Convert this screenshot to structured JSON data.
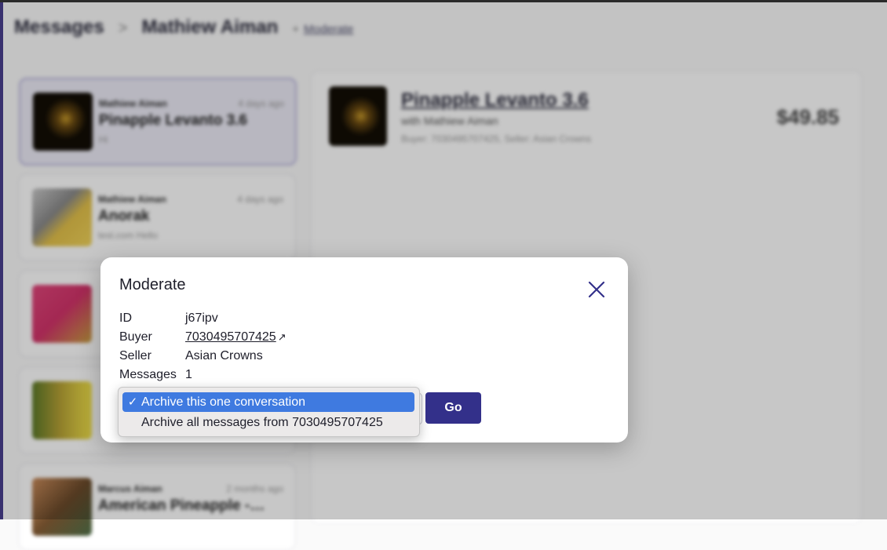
{
  "background": {
    "breadcrumb": {
      "messages": "Messages",
      "separator": ">",
      "user": "Mathiew Aiman",
      "plus": "+",
      "moderate_link": "Moderate"
    },
    "conversations": [
      {
        "seller": "Mathiew Aiman",
        "time": "4 days ago",
        "title": "Pinapple Levanto 3.6",
        "snippet": "Hi",
        "active": true
      },
      {
        "seller": "Mathiew Aiman",
        "time": "4 days ago",
        "title": "Anorak",
        "snippet": "test.com Hello",
        "active": false
      },
      {
        "seller": "",
        "time": "",
        "title": "",
        "snippet": "",
        "active": false
      },
      {
        "seller": "",
        "time": "",
        "title": "",
        "snippet": "",
        "active": false
      },
      {
        "seller": "Marcus Aiman",
        "time": "2 months ago",
        "title": "American Pineapple -…",
        "snippet": "",
        "active": false
      }
    ],
    "detail": {
      "title": "Pinapple Levanto 3.6",
      "with_text": "with Mathiew Aiman",
      "sub_text": "Buyer: 7030495707425, Seller: Asian Crowns",
      "price": "$49.85"
    }
  },
  "modal": {
    "title": "Moderate",
    "fields": [
      {
        "label": "ID",
        "value": "j67ipv",
        "link": false
      },
      {
        "label": "Buyer",
        "value": "7030495707425",
        "link": true,
        "link_icon": "↗"
      },
      {
        "label": "Seller",
        "value": "Asian Crowns",
        "link": false
      },
      {
        "label": "Messages",
        "value": "1",
        "link": false
      }
    ],
    "select": {
      "options": [
        {
          "label": "Archive this one conversation",
          "selected": true
        },
        {
          "label": "Archive all messages from 7030495707425",
          "selected": false
        }
      ],
      "check_mark": "✓"
    },
    "go_label": "Go"
  },
  "colors": {
    "accent": "#33308a",
    "selection": "#3f7ae0",
    "sidebar_accent": "#4a3f8f"
  }
}
